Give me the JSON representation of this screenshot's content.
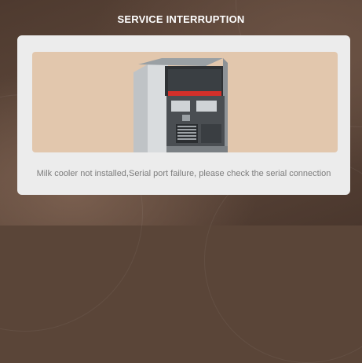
{
  "header": {
    "title": "SERVICE INTERRUPTION"
  },
  "alert": {
    "image_alt": "coffee-machine",
    "message": "Milk cooler not installed,Serial port failure, please check the serial connection"
  },
  "colors": {
    "background": "#5a4538",
    "card": "#ececec",
    "image_panel": "#e2c7ad",
    "message_text": "#7d7d7d"
  }
}
